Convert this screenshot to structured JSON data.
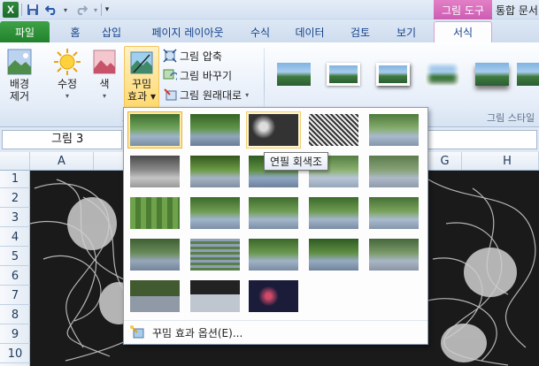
{
  "app": {
    "logo": "X",
    "title": "통합 문서"
  },
  "quick_access": {
    "save_icon": "save-icon",
    "undo_icon": "undo-icon",
    "redo_icon": "redo-icon",
    "customize_icon": "dropdown-icon"
  },
  "context_tab_header": "그림 도구",
  "tabs": [
    {
      "label": "파일"
    },
    {
      "label": "홈"
    },
    {
      "label": "삽입"
    },
    {
      "label": "페이지 레이아웃"
    },
    {
      "label": "수식"
    },
    {
      "label": "데이터"
    },
    {
      "label": "검토"
    },
    {
      "label": "보기"
    },
    {
      "label": "서식"
    }
  ],
  "ribbon": {
    "remove_bg": {
      "line1": "배경",
      "line2": "제거"
    },
    "corrections": {
      "label": "수정"
    },
    "color": {
      "label": "색"
    },
    "artistic": {
      "line1": "꾸밈",
      "line2": "효과"
    },
    "compress": "그림 압축",
    "change": "그림 바꾸기",
    "reset": "그림 원래대로",
    "adjust_group_label": "조",
    "styles_group_label": "그림 스타일"
  },
  "namebox": {
    "value": "그림 3"
  },
  "columns": [
    "A",
    "G",
    "H"
  ],
  "rows": [
    "1",
    "2",
    "3",
    "4",
    "5",
    "6",
    "7",
    "8",
    "9",
    "10"
  ],
  "gallery": {
    "tooltip": "연필 회색조",
    "footer_label": "꾸밈 효과 옵션(E)...",
    "effects_count": 23
  },
  "colors": {
    "accent_file": "#21822c",
    "context_pink": "#cc5db2",
    "selected_border": "#e8b53c"
  }
}
